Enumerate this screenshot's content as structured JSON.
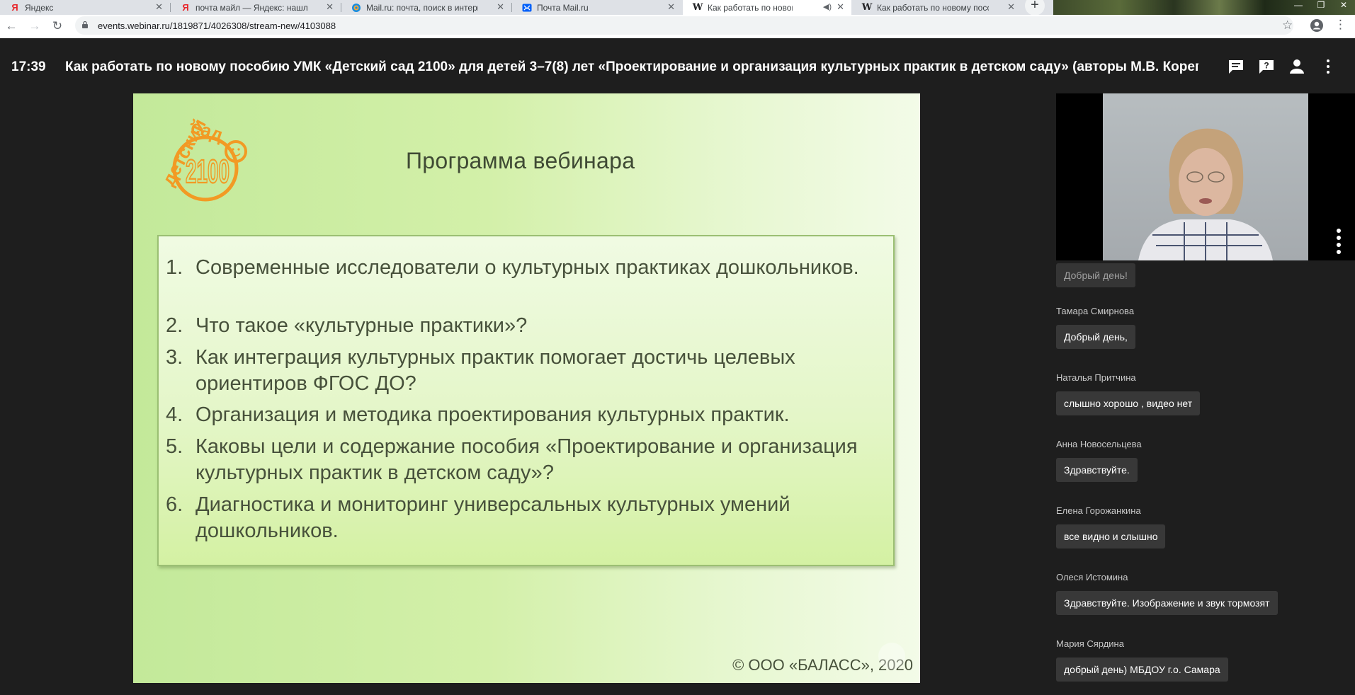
{
  "browser": {
    "tabs": [
      {
        "title": "Яндекс",
        "favicon": "yandex-icon",
        "active": false
      },
      {
        "title": "почта майл — Яндекс: нашлось",
        "favicon": "yandex-icon",
        "active": false
      },
      {
        "title": "Mail.ru: почта, поиск в интернет",
        "favicon": "mailru-icon",
        "active": false
      },
      {
        "title": "Почта Mail.ru",
        "favicon": "mail-envelope-icon",
        "active": false
      },
      {
        "title": "Как работать по новому пособ",
        "favicon": "webinar-w-icon",
        "active": true,
        "muted": true
      },
      {
        "title": "Как работать по новому пособ",
        "favicon": "webinar-w-icon",
        "active": false
      }
    ],
    "url": "events.webinar.ru/1819871/4026308/stream-new/4103088"
  },
  "header": {
    "time": "17:39",
    "title": "Как работать по новому пособию УМК «Детский сад 2100» для детей 3–7(8) лет «Проектирование и организация культурных практик в детском саду» (авторы М.В. Корепанова, ..."
  },
  "slide": {
    "logo_text_top": "сад",
    "logo_text_side": "детский",
    "logo_number": "2100",
    "title": "Программа вебинара",
    "items": [
      {
        "num": "1.",
        "text": "Современные исследователи о культурных практиках дошкольников."
      },
      {
        "num": "2.",
        "text": "Что такое «культурные практики»?"
      },
      {
        "num": "3.",
        "text": "Как интеграция культурных практик помогает достичь целевых ориентиров ФГОС ДО?"
      },
      {
        "num": "4.",
        "text": "Организация и методика проектирования культурных практик."
      },
      {
        "num": "5.",
        "text": "Каковы цели и содержание пособия «Проектирование и организация культурных практик в детском саду»?"
      },
      {
        "num": "6.",
        "text": "Диагностика и мониторинг универсальных культурных умений дошкольников."
      }
    ],
    "copyright": "© ООО «БАЛАСС», 2020"
  },
  "chat": {
    "messages": [
      {
        "author": "",
        "text": "Добрый день!"
      },
      {
        "author": "Тамара Смирнова",
        "text": "Добрый день,"
      },
      {
        "author": "Наталья Притчина",
        "text": "слышно хорошо , видео нет"
      },
      {
        "author": "Анна Новосельцева",
        "text": "Здравствуйте."
      },
      {
        "author": "Елена Горожанкина",
        "text": "все видно и слышно"
      },
      {
        "author": "Олеся Истомина",
        "text": "Здравствуйте. Изображение и звук тормозят"
      },
      {
        "author": "Мария Сярдина",
        "text": "добрый день) МБДОУ г.о. Самара"
      }
    ]
  },
  "colors": {
    "logo_orange": "#f29a24",
    "slide_text": "#47513b",
    "page_bg": "#1e1e1e"
  }
}
